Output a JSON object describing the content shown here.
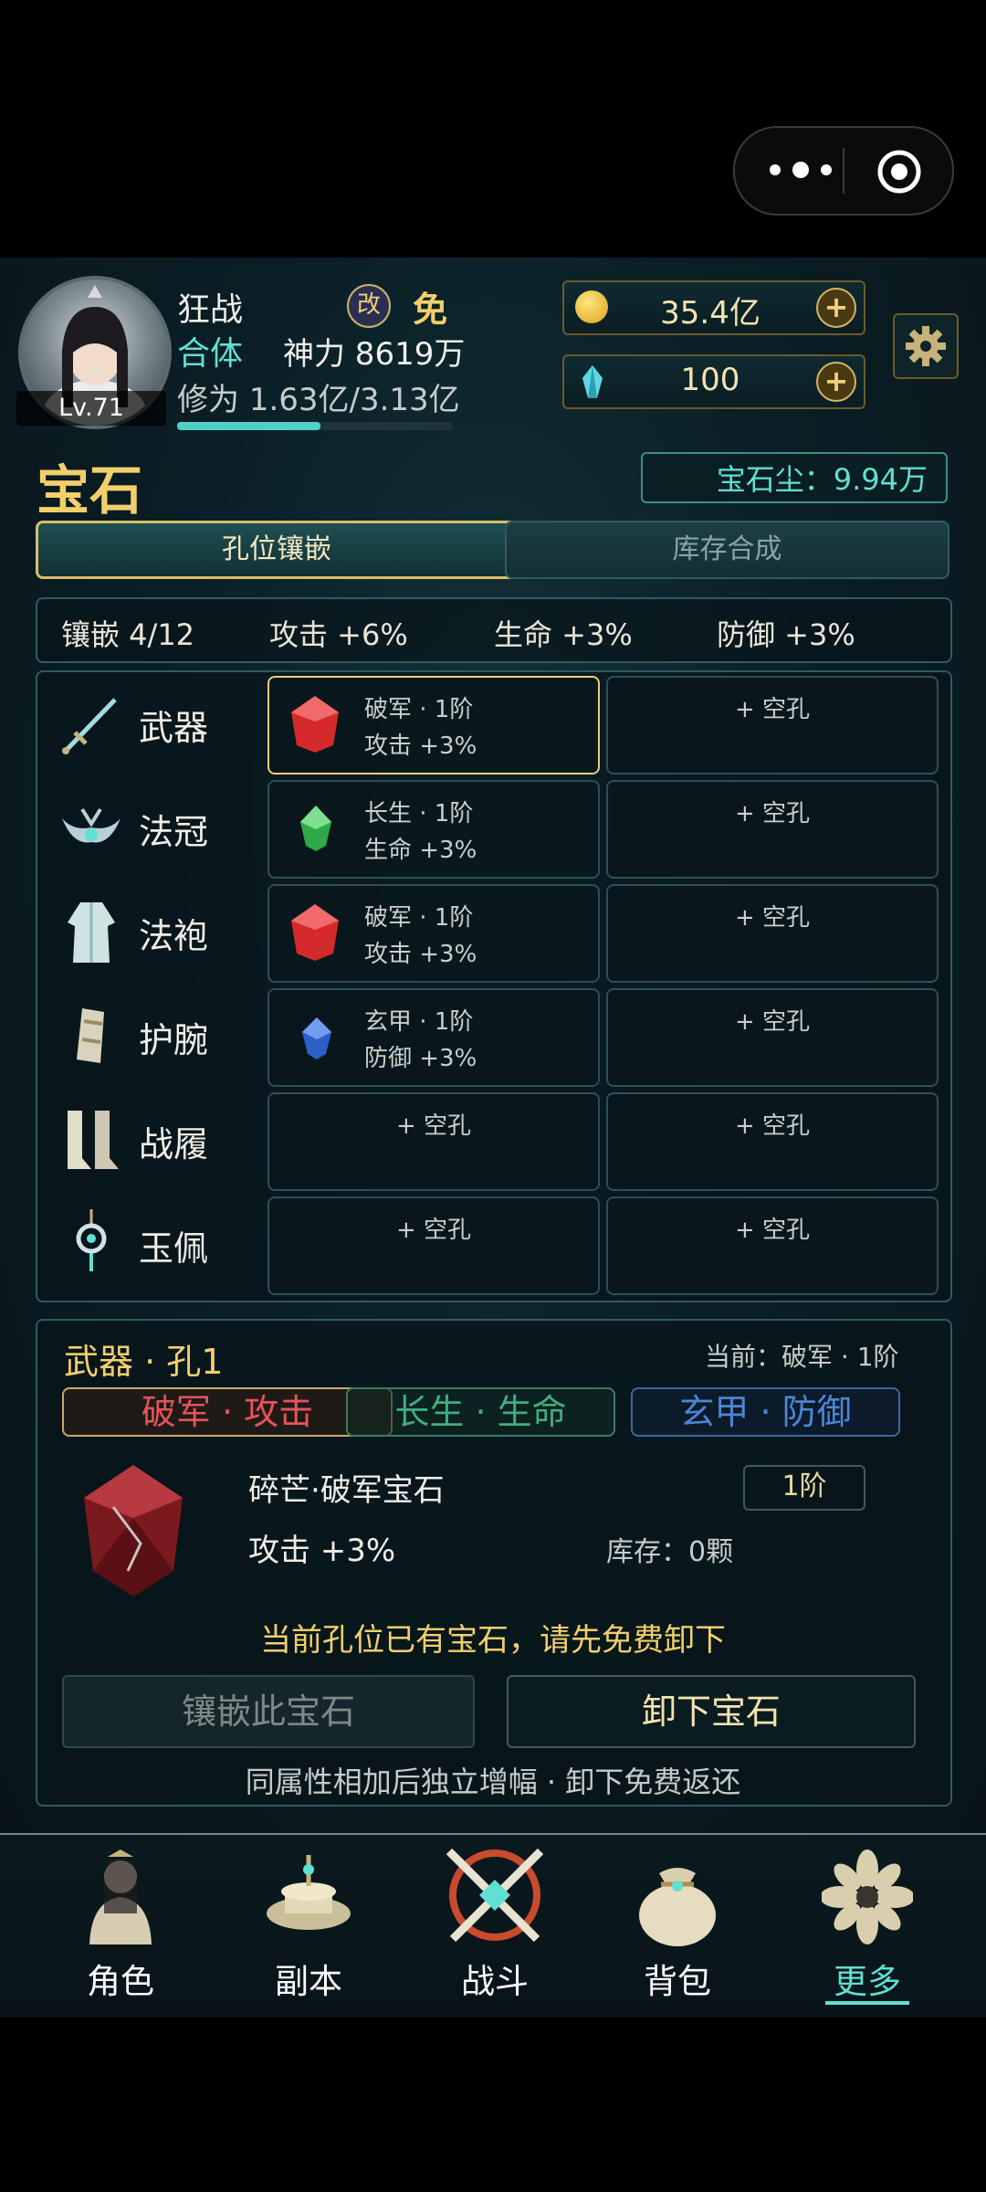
{
  "capsule": {
    "more_icon": "more-dots-icon",
    "record_icon": "target-icon"
  },
  "header": {
    "name": "狂战",
    "tag_badge": "改",
    "tag_text": "免",
    "realm": "合体",
    "power_label": "神力 8619万",
    "xp": "修为 1.63亿/3.13亿",
    "xp_progress": 0.52,
    "level": "Lv.71"
  },
  "resources": {
    "gold": "35.4亿",
    "gem": "100"
  },
  "page": {
    "title": "宝石",
    "dust": "宝石尘：9.94万"
  },
  "tabs": {
    "active": "孔位镶嵌",
    "inactive": "库存合成"
  },
  "summary": {
    "inlay": "镶嵌 4/12",
    "attack": "攻击 +6%",
    "life": "生命 +3%",
    "defense": "防御 +3%"
  },
  "equipment": [
    {
      "name": "武器",
      "slot1_line1": "破军 · 1阶",
      "slot1_line2": "攻击 +3%",
      "slot1_gem": "red",
      "slot2": "+ 空孔"
    },
    {
      "name": "法冠",
      "slot1_line1": "长生 · 1阶",
      "slot1_line2": "生命 +3%",
      "slot1_gem": "green",
      "slot2": "+ 空孔"
    },
    {
      "name": "法袍",
      "slot1_line1": "破军 · 1阶",
      "slot1_line2": "攻击 +3%",
      "slot1_gem": "red",
      "slot2": "+ 空孔"
    },
    {
      "name": "护腕",
      "slot1_line1": "玄甲 · 1阶",
      "slot1_line2": "防御 +3%",
      "slot1_gem": "blue",
      "slot2": "+ 空孔"
    },
    {
      "name": "战履",
      "slot1_line1": "+ 空孔",
      "slot2": "+ 空孔"
    },
    {
      "name": "玉佩",
      "slot1_line1": "+ 空孔",
      "slot2": "+ 空孔"
    }
  ],
  "detail": {
    "title": "武器 · 孔1",
    "current": "当前：破军 · 1阶",
    "types": [
      "破军 · 攻击",
      "长生 · 生命",
      "玄甲 · 防御"
    ],
    "gem_name": "碎芒·破军宝石",
    "gem_tier": "1阶",
    "gem_effect": "攻击 +3%",
    "stock": "库存：0颗",
    "notice": "当前孔位已有宝石，请先免费卸下",
    "inlay_button": "镶嵌此宝石",
    "remove_button": "卸下宝石",
    "footer": "同属性相加后独立增幅 · 卸下免费返还"
  },
  "nav": [
    "角色",
    "副本",
    "战斗",
    "背包",
    "更多"
  ],
  "colors": {
    "accent": "#5fe0d3",
    "gold": "#f3cf6b",
    "attack": "#e8525a",
    "life": "#3fae7e",
    "defense": "#4d85d8"
  }
}
